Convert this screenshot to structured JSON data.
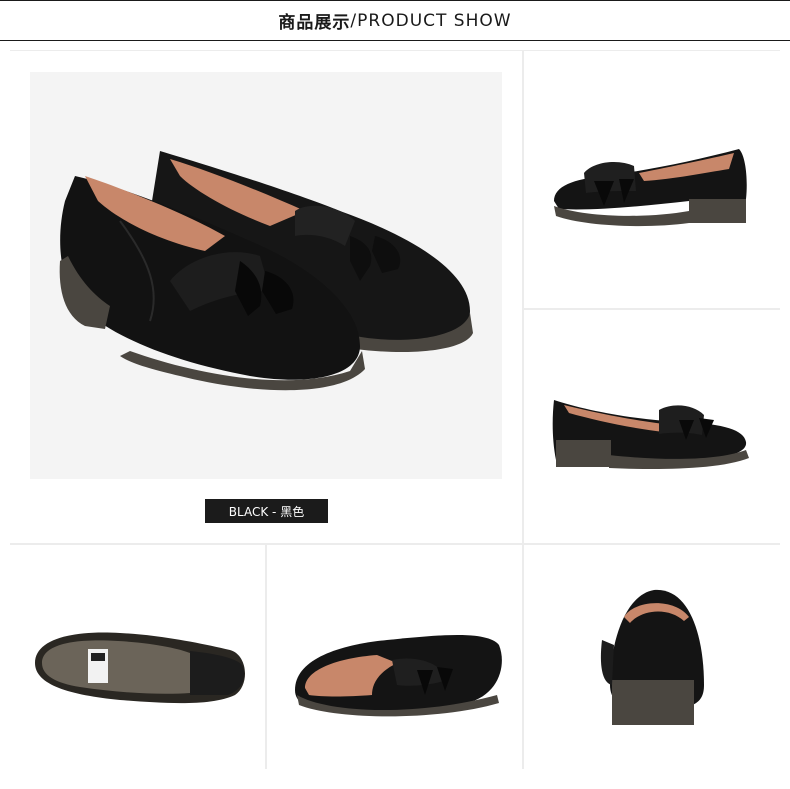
{
  "header": {
    "title_cn": "商品展示",
    "title_sep": "/",
    "title_en": "PRODUCT SHOW"
  },
  "product": {
    "color_label": "BLACK - 黑色"
  },
  "colors": {
    "leather": "#141414",
    "lining": "#c8876a",
    "sole": "#4a4640",
    "background": "#f4f4f4"
  },
  "views": [
    "pair-three-quarter",
    "side-left",
    "side-right",
    "sole-bottom",
    "top-down",
    "rear"
  ]
}
